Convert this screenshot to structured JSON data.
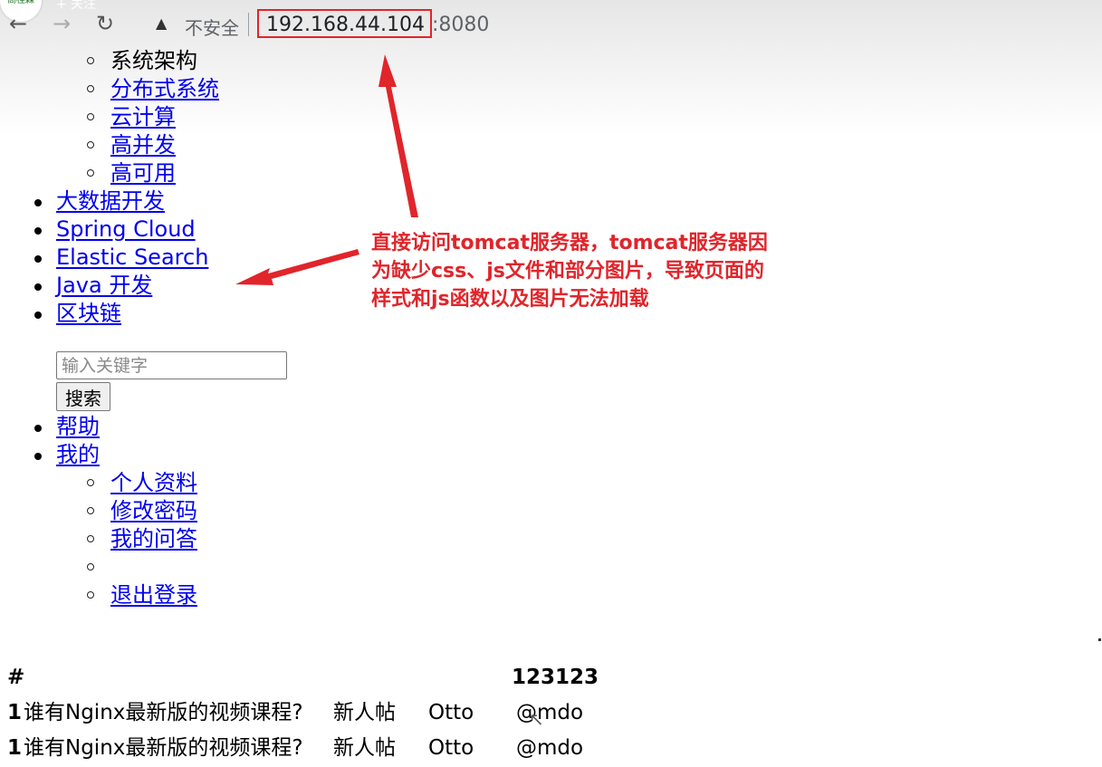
{
  "browser": {
    "badge_text": "高桂森",
    "follow_text": "+ 关注",
    "back_icon": "←",
    "forward_icon": "→",
    "reload_icon": "↻",
    "warning_icon": "▲",
    "insecure_label": "不安全",
    "url_host": "192.168.44.104",
    "url_port": ":8080"
  },
  "menu": {
    "top_sub": [
      {
        "label": "系统架构",
        "link": false
      },
      {
        "label": "分布式系统",
        "link": true
      },
      {
        "label": "云计算",
        "link": true
      },
      {
        "label": "高并发",
        "link": true
      },
      {
        "label": "高可用",
        "link": true
      }
    ],
    "main_items": [
      "大数据开发",
      "Spring Cloud",
      "Elastic Search",
      "Java 开发",
      "区块链"
    ],
    "search": {
      "placeholder": "输入关键字",
      "button": "搜索"
    },
    "help": "帮助",
    "mine": "我的",
    "mine_sub": [
      "个人资料",
      "修改密码",
      "我的问答",
      "",
      "退出登录"
    ]
  },
  "table": {
    "header": {
      "hash": "#",
      "col": "123123"
    },
    "rows": [
      {
        "num": "1",
        "title": "谁有Nginx最新版的视频课程?",
        "tag": "新人帖",
        "author": "Otto",
        "handle": "@mdo"
      },
      {
        "num": "1",
        "title": "谁有Nginx最新版的视频课程?",
        "tag": "新人帖",
        "author": "Otto",
        "handle": "@mdo"
      }
    ]
  },
  "annotation": {
    "text": "直接访问tomcat服务器，tomcat服务器因为缺少css、js文件和部分图片，导致页面的样式和js函数以及图片无法加载",
    "color": "#e0252b"
  }
}
